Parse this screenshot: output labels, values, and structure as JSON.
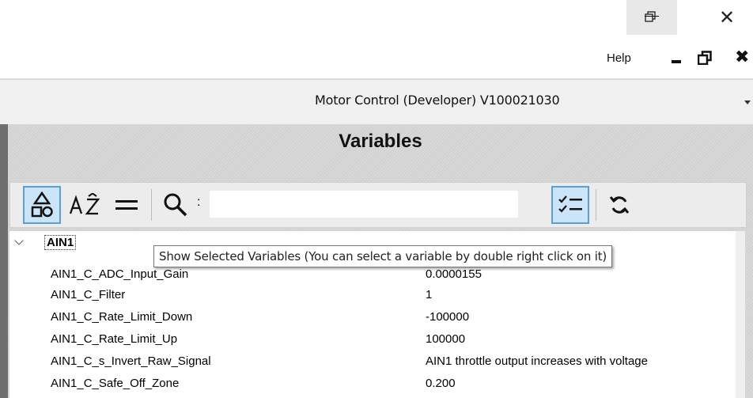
{
  "window": {
    "controls": [
      "minimize",
      "restore",
      "close"
    ]
  },
  "menu": {
    "help_label": "Help"
  },
  "app_selector": {
    "selected": "Motor Control (Developer) V100021030"
  },
  "panel": {
    "title": "Variables"
  },
  "toolbar": {
    "buttons": [
      "group-by-category",
      "sort-alphabetical",
      "flat-list",
      "search",
      "show-selected-variables",
      "refresh"
    ],
    "search_colon": ":",
    "search_value": ""
  },
  "tree": {
    "group": {
      "name": "AIN1",
      "expanded": true
    },
    "rows": [
      {
        "name": "AIN1_C_ADC_Input_Gain",
        "value": "0.0000155"
      },
      {
        "name": "AIN1_C_Filter",
        "value": "1"
      },
      {
        "name": "AIN1_C_Rate_Limit_Down",
        "value": "-100000"
      },
      {
        "name": "AIN1_C_Rate_Limit_Up",
        "value": "100000"
      },
      {
        "name": "AIN1_C_s_Invert_Raw_Signal",
        "value": "AIN1 throttle output increases with voltage"
      },
      {
        "name": "AIN1_C_Safe_Off_Zone",
        "value": "0.200"
      }
    ]
  },
  "tooltip": {
    "text": "Show Selected Variables (You can select a variable by double right click on it)"
  }
}
